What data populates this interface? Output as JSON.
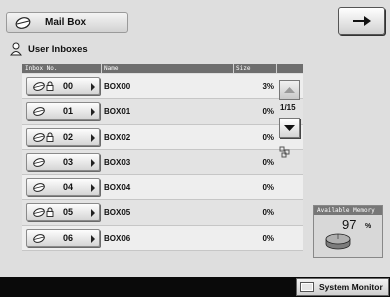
{
  "header": {
    "title": "Mail Box",
    "subtitle": "User Inboxes"
  },
  "table": {
    "columns": [
      "Inbox No.",
      "Name",
      "Size"
    ],
    "rows": [
      {
        "no": "00",
        "name": "BOX00",
        "size": "3%",
        "locked": true
      },
      {
        "no": "01",
        "name": "BOX01",
        "size": "0%",
        "locked": false
      },
      {
        "no": "02",
        "name": "BOX02",
        "size": "0%",
        "locked": true
      },
      {
        "no": "03",
        "name": "BOX03",
        "size": "0%",
        "locked": false
      },
      {
        "no": "04",
        "name": "BOX04",
        "size": "0%",
        "locked": false
      },
      {
        "no": "05",
        "name": "BOX05",
        "size": "0%",
        "locked": true
      },
      {
        "no": "06",
        "name": "BOX06",
        "size": "0%",
        "locked": false
      }
    ]
  },
  "pager": {
    "page": "1/15"
  },
  "memory": {
    "title": "Available Memory",
    "value": "97",
    "unit": "%"
  },
  "footer": {
    "system_monitor": "System Monitor"
  }
}
